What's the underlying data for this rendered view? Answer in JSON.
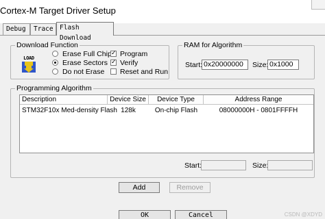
{
  "window": {
    "title": "Cortex-M Target Driver Setup"
  },
  "tabs": [
    {
      "label": "Debug"
    },
    {
      "label": "Trace"
    },
    {
      "label": "Flash Download"
    }
  ],
  "download_function": {
    "label": "Download Function",
    "icon_text": "LOAD",
    "radios": [
      {
        "label": "Erase Full Chip",
        "checked": false
      },
      {
        "label": "Erase Sectors",
        "checked": true
      },
      {
        "label": "Do not Erase",
        "checked": false
      }
    ],
    "checks": [
      {
        "label": "Program",
        "checked": true
      },
      {
        "label": "Verify",
        "checked": true
      },
      {
        "label": "Reset and Run",
        "checked": false
      }
    ]
  },
  "ram_for_algorithm": {
    "label": "RAM for Algorithm",
    "start_label": "Start:",
    "start_value": "0x20000000",
    "size_label": "Size:",
    "size_value": "0x1000"
  },
  "programming_algorithm": {
    "label": "Programming Algorithm",
    "columns": [
      "Description",
      "Device Size",
      "Device Type",
      "Address Range"
    ],
    "rows": [
      [
        "STM32F10x Med-density Flash",
        "128k",
        "On-chip Flash",
        "08000000H - 0801FFFFH"
      ]
    ],
    "start_label": "Start:",
    "size_label": "Size:",
    "start_value": "",
    "size_value": ""
  },
  "buttons": {
    "add": "Add",
    "remove": "Remove",
    "ok": "OK",
    "cancel": "Cancel"
  },
  "watermark": "CSDN @XDYD"
}
